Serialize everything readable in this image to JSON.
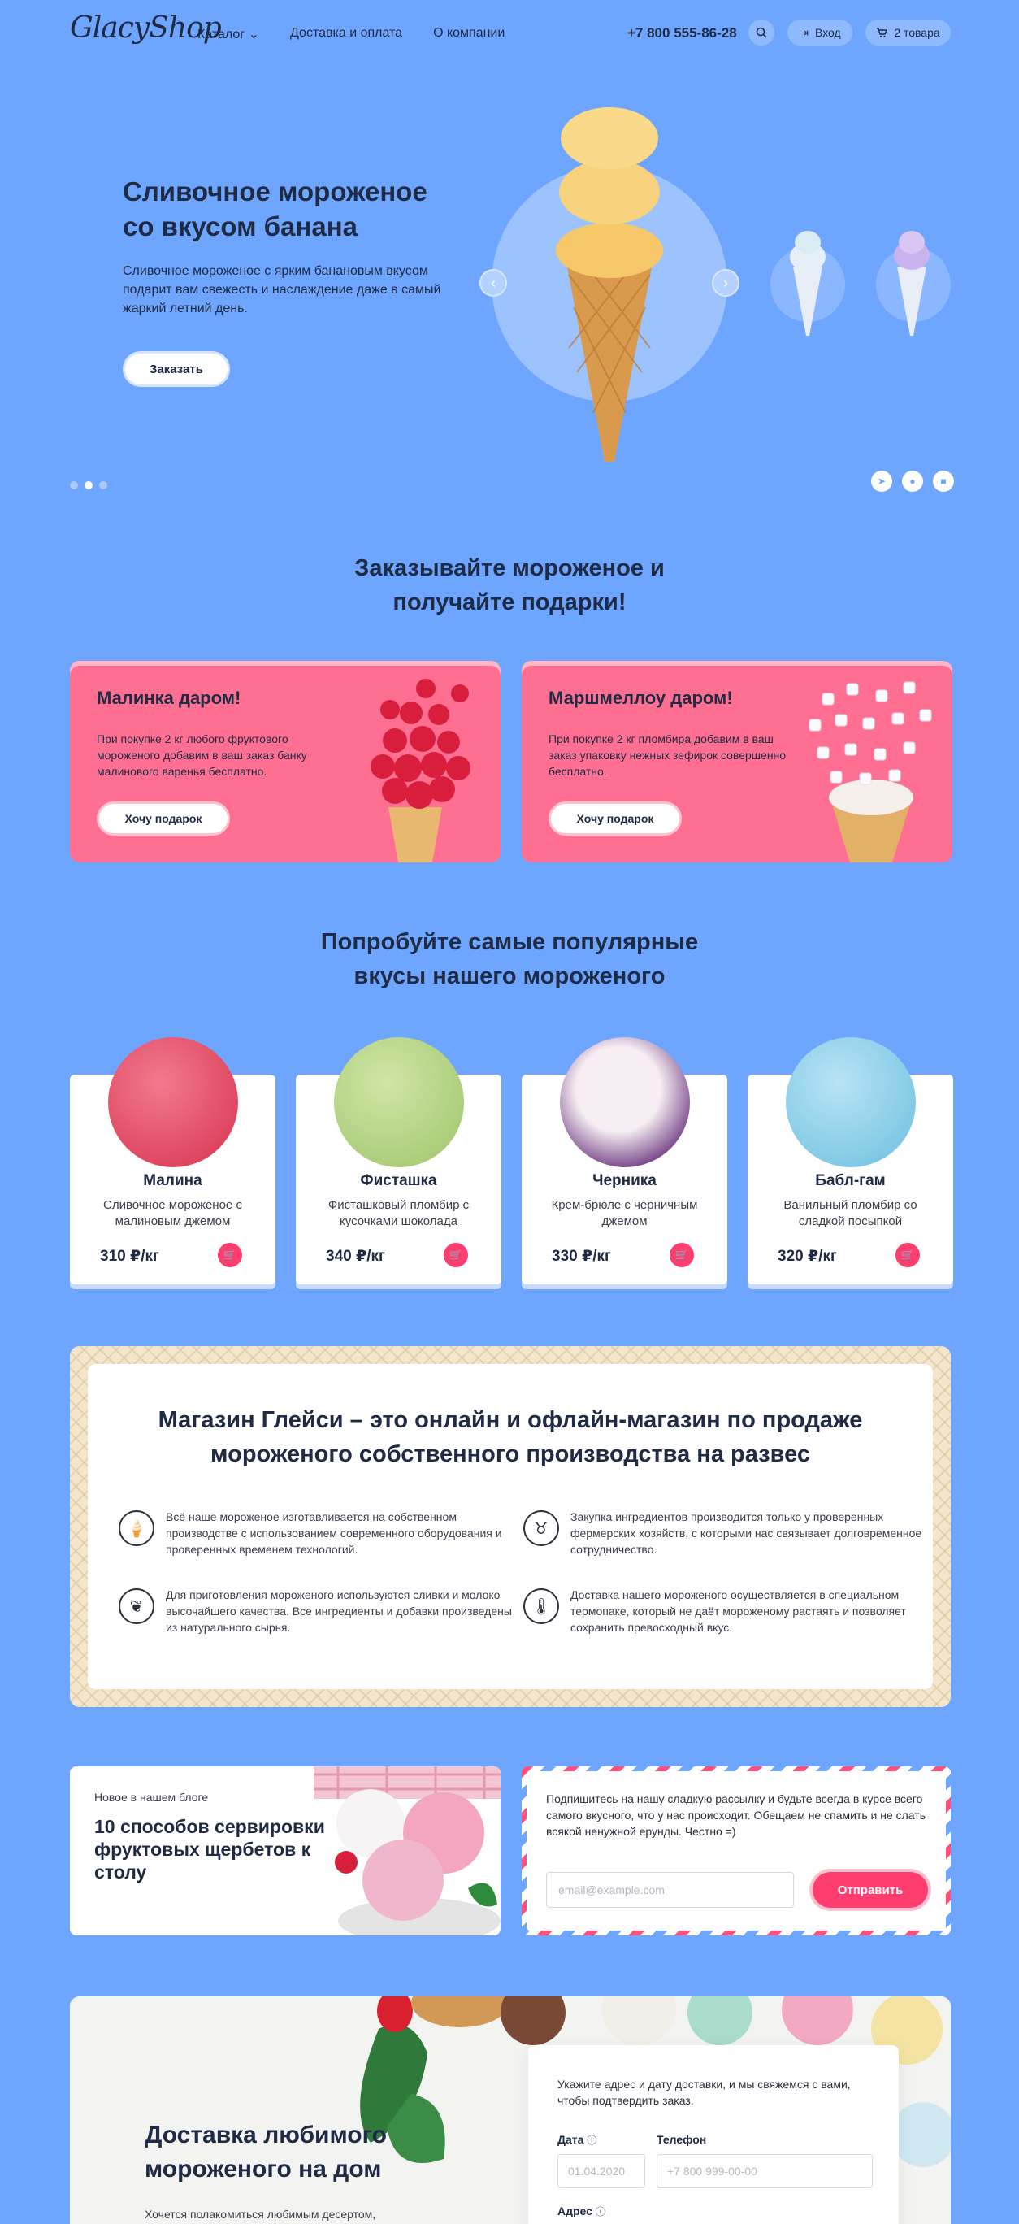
{
  "header": {
    "logo": "GlacyShop",
    "nav": [
      "Каталог",
      "Доставка и оплата",
      "О компании"
    ],
    "phone": "+7 800 555-86-28",
    "login": "Вход",
    "cart": "2 товара"
  },
  "hero": {
    "title": "Сливочное мороженое со вкусом банана",
    "description": "Сливочное мороженое с ярким банановым вкусом подарит вам свежесть и наслаждение даже в самый жаркий летний день.",
    "order_button": "Заказать"
  },
  "gifts_section": {
    "title": "Заказывайте мороженое и получайте подарки!",
    "cards": [
      {
        "title": "Малинка даром!",
        "description": "При покупке 2 кг любого фруктового мороженого добавим в ваш заказ банку малинового варенья бесплатно.",
        "button": "Хочу подарок"
      },
      {
        "title": "Маршмеллоу даром!",
        "description": "При покупке 2 кг пломбира добавим в ваш заказ упаковку нежных зефирок совершенно бесплатно.",
        "button": "Хочу подарок"
      }
    ]
  },
  "flavors_section": {
    "title": "Попробуйте самые популярные вкусы нашего мороженого",
    "items": [
      {
        "name": "Малина",
        "description": "Сливочное мороженое с малиновым джемом",
        "price": "310 ₽/кг",
        "color": "#e8506a"
      },
      {
        "name": "Фисташка",
        "description": "Фисташковый пломбир с кусочками шоколада",
        "price": "340 ₽/кг",
        "color": "#b9d98c"
      },
      {
        "name": "Черника",
        "description": "Крем-брюле с черничным джемом",
        "price": "330 ₽/кг",
        "color": "#efe4ea"
      },
      {
        "name": "Бабл-гам",
        "description": "Ванильный пломбир со сладкой посыпкой",
        "price": "320 ₽/кг",
        "color": "#8fd0ea"
      }
    ]
  },
  "about": {
    "title": "Магазин Глейси – это онлайн и офлайн-магазин по продаже мороженого собственного производства на развес",
    "features": [
      {
        "text": "Всё наше мороженое изготавливается на собственном производстве с использованием современного оборудования и проверенных временем технологий.",
        "icon": "ice-cream-icon"
      },
      {
        "text": "Закупка ингредиентов производится только у проверенных фермерских хозяйств, с которыми нас связывает долговременное сотрудничество.",
        "icon": "cow-icon"
      },
      {
        "text": "Для приготовления мороженого используются сливки и молоко высочайшего качества. Все ингредиенты и добавки произведены из натурального сырья.",
        "icon": "leaf-icon"
      },
      {
        "text": "Доставка нашего мороженого осуществляется в специальном термопаке, который не даёт мороженому растаять и позволяет сохранить превосходный вкус.",
        "icon": "thermometer-icon"
      }
    ]
  },
  "blog": {
    "tag": "Новое в нашем блоге",
    "title": "10 способов сервировки фруктовых щербетов к столу"
  },
  "newsletter": {
    "text": "Подпишитесь на нашу сладкую рассылку и будьте всегда в курсе всего самого вкусного, что у нас происходит. Обещаем не спамить и не слать всякой ненужной ерунды. Честно =)",
    "email_placeholder": "email@example.com",
    "button": "Отправить"
  },
  "delivery": {
    "title": "Доставка любимого мороженого на дом",
    "subtitle": "Хочется полакомиться любимым десертом,",
    "note": "Укажите адрес и дату доставки, и мы свяжемся с вами, чтобы подтвердить заказ.",
    "date_label": "Дата",
    "date_placeholder": "01.04.2020",
    "phone_label": "Телефон",
    "phone_placeholder": "+7 800 999-00-00",
    "address_label": "Адрес"
  }
}
